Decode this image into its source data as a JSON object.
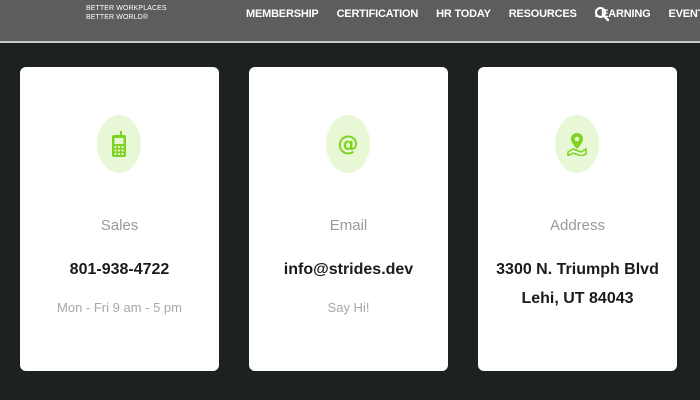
{
  "header": {
    "logo_line1": "BETTER WORKPLACES",
    "logo_line2": "BETTER WORLD®",
    "nav": [
      {
        "label": "MEMBERSHIP"
      },
      {
        "label": "CERTIFICATION"
      },
      {
        "label": "HR TODAY"
      },
      {
        "label": "RESOURCES"
      },
      {
        "label": "LEARNING"
      },
      {
        "label": "EVENTS"
      }
    ],
    "search_icon": "search-icon"
  },
  "cards": [
    {
      "icon": "phone-icon",
      "label": "Sales",
      "value": "801-938-4722",
      "value_line2": "",
      "sub": "Mon - Fri 9 am - 5 pm"
    },
    {
      "icon": "at-icon",
      "label": "Email",
      "value": "info@strides.dev",
      "value_line2": "",
      "sub": "Say Hi!"
    },
    {
      "icon": "map-pin-icon",
      "label": "Address",
      "value": "3300 N. Triumph Blvd",
      "value_line2": "Lehi, UT 84043",
      "sub": ""
    }
  ],
  "colors": {
    "page_bg": "#1d2120",
    "topbar_bg": "#5d5d5d",
    "accent_green": "#7ed321",
    "icon_circle_bg": "#e8f8d6"
  }
}
